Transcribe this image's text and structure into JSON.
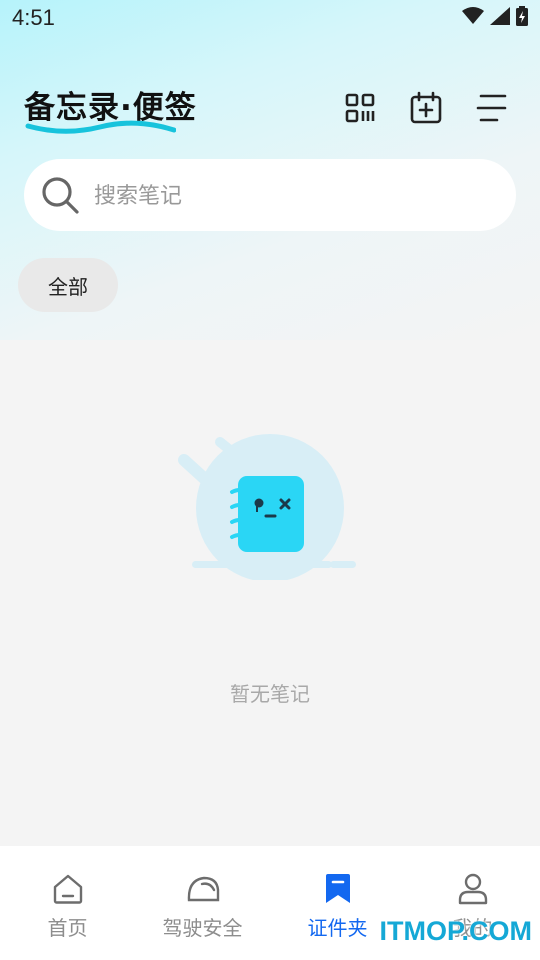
{
  "status_bar": {
    "time": "4:51"
  },
  "header": {
    "title": "备忘录·便签",
    "icons": [
      "grid-qr-icon",
      "calendar-add-icon",
      "menu-icon"
    ]
  },
  "search": {
    "placeholder": "搜索笔记"
  },
  "filter": {
    "chip_label": "全部"
  },
  "empty_state": {
    "message": "暂无笔记"
  },
  "tab_bar": {
    "tabs": [
      {
        "label": "首页",
        "icon": "home-icon",
        "active": false
      },
      {
        "label": "驾驶安全",
        "icon": "helmet-icon",
        "active": false
      },
      {
        "label": "证件夹",
        "icon": "bookmark-icon",
        "active": true
      },
      {
        "label": "我的",
        "icon": "person-icon",
        "active": false
      }
    ]
  },
  "watermark": "ITMOP.COM",
  "colors": {
    "accent": "#1368f0",
    "title_underline": "#17c3dc",
    "illustration": "#2ad6f5"
  }
}
